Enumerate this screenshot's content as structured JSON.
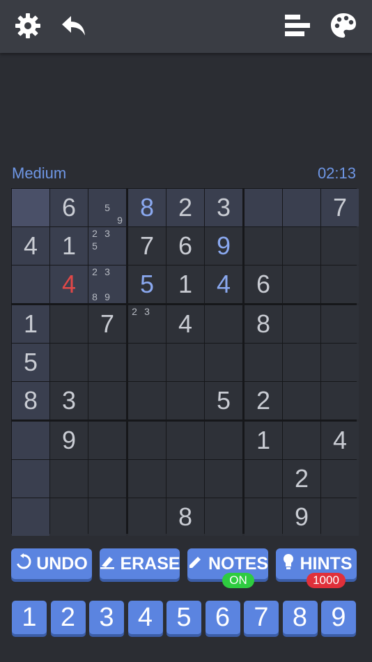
{
  "toolbar": {
    "settings_icon": "gear-icon",
    "back_icon": "back-arrow-icon",
    "stats_icon": "bars-icon",
    "theme_icon": "palette-icon"
  },
  "game": {
    "difficulty": "Medium",
    "timer": "02:13"
  },
  "board": {
    "rows": [
      [
        "",
        "6",
        "",
        "8",
        "2",
        "3",
        "",
        "",
        "7"
      ],
      [
        "4",
        "1",
        "",
        "7",
        "6",
        "9",
        "",
        "",
        ""
      ],
      [
        "",
        "4",
        "",
        "5",
        "1",
        "4",
        "6",
        "",
        ""
      ],
      [
        "1",
        "",
        "7",
        "",
        "4",
        "",
        "8",
        "",
        ""
      ],
      [
        "5",
        "",
        "",
        "",
        "",
        "",
        "",
        "",
        ""
      ],
      [
        "8",
        "3",
        "",
        "",
        "",
        "5",
        "2",
        "",
        ""
      ],
      [
        "",
        "9",
        "",
        "",
        "",
        "",
        "1",
        "",
        "4"
      ],
      [
        "",
        "",
        "",
        "",
        "",
        "",
        "",
        "2",
        ""
      ],
      [
        "",
        "",
        "",
        "",
        "8",
        "",
        "",
        "9",
        ""
      ]
    ],
    "user_cells": [
      "0-3",
      "1-5",
      "2-3",
      "2-5"
    ],
    "error_cells": [
      "2-1"
    ],
    "notes": {
      "0-2": [
        "",
        "",
        "",
        "",
        "5",
        "",
        "",
        "",
        "9"
      ],
      "1-2": [
        "2",
        "3",
        "",
        "5",
        "",
        "",
        "",
        "",
        ""
      ],
      "2-2": [
        "2",
        "3",
        "",
        "",
        "",
        "",
        "8",
        "9",
        ""
      ],
      "3-3": [
        "2",
        "3",
        "",
        "",
        "",
        "",
        "",
        "",
        ""
      ]
    }
  },
  "actions": {
    "undo_label": "UNDO",
    "undo_icon": "undo-icon",
    "erase_label": "ERASE",
    "erase_icon": "eraser-icon",
    "notes_label": "NOTES",
    "notes_icon": "pencil-icon",
    "notes_state": "ON",
    "hints_label": "HINTS",
    "hints_icon": "lightbulb-icon",
    "hints_count": "1000"
  },
  "numpad": [
    "1",
    "2",
    "3",
    "4",
    "5",
    "6",
    "7",
    "8",
    "9"
  ],
  "colors": {
    "accent": "#5b84e0",
    "badge_on": "#2ecc40",
    "badge_count": "#e0303a",
    "error": "#e04848"
  }
}
